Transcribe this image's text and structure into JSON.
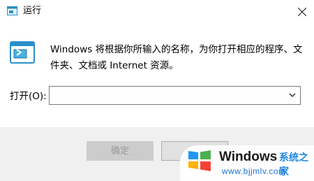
{
  "window": {
    "title": "运行",
    "app_icon": "run-app-icon",
    "close_icon": "close-icon"
  },
  "content": {
    "run_icon": "run-dialog-icon",
    "description": "Windows 将根据你所输入的名称，为你打开相应的程序、文件夹、文档或 Internet 资源。",
    "open_label": "打开(O):",
    "open_value": ""
  },
  "buttons": {
    "ok_label": "确定",
    "cancel_label": ""
  },
  "watermark": {
    "brand": "Windows",
    "brand_cn": "系统之家",
    "url": "www.bjjmlv.com"
  },
  "colors": {
    "accent": "#1e88e5",
    "footer_bg": "#f0f0f0",
    "button_disabled": "#cccccc"
  }
}
